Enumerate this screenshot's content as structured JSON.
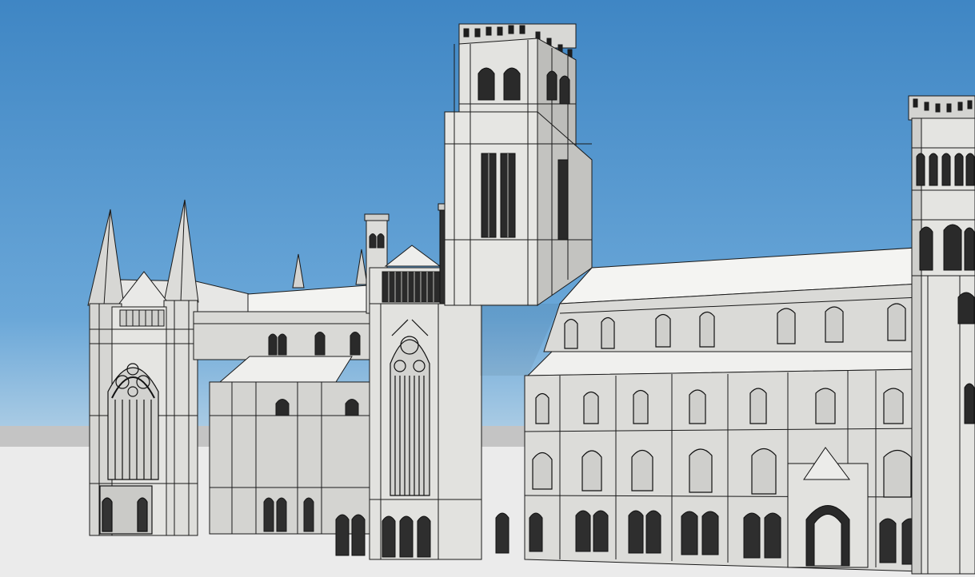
{
  "scene": {
    "subject": "durham-cathedral-3d-model",
    "render_style": "clay render with wireframe edges"
  },
  "colors": {
    "sky_top": "#3f86c4",
    "sky_bottom": "#a9cbe4",
    "ground": "#e9e9e9",
    "stone_light": "#f1f1ef",
    "stone_mid": "#d9d9d6",
    "stone_shadow": "#b9b9b6",
    "edge": "#1a1a1a",
    "window_dark": "#2a2a2a"
  },
  "overlay": {
    "watermark": ""
  }
}
